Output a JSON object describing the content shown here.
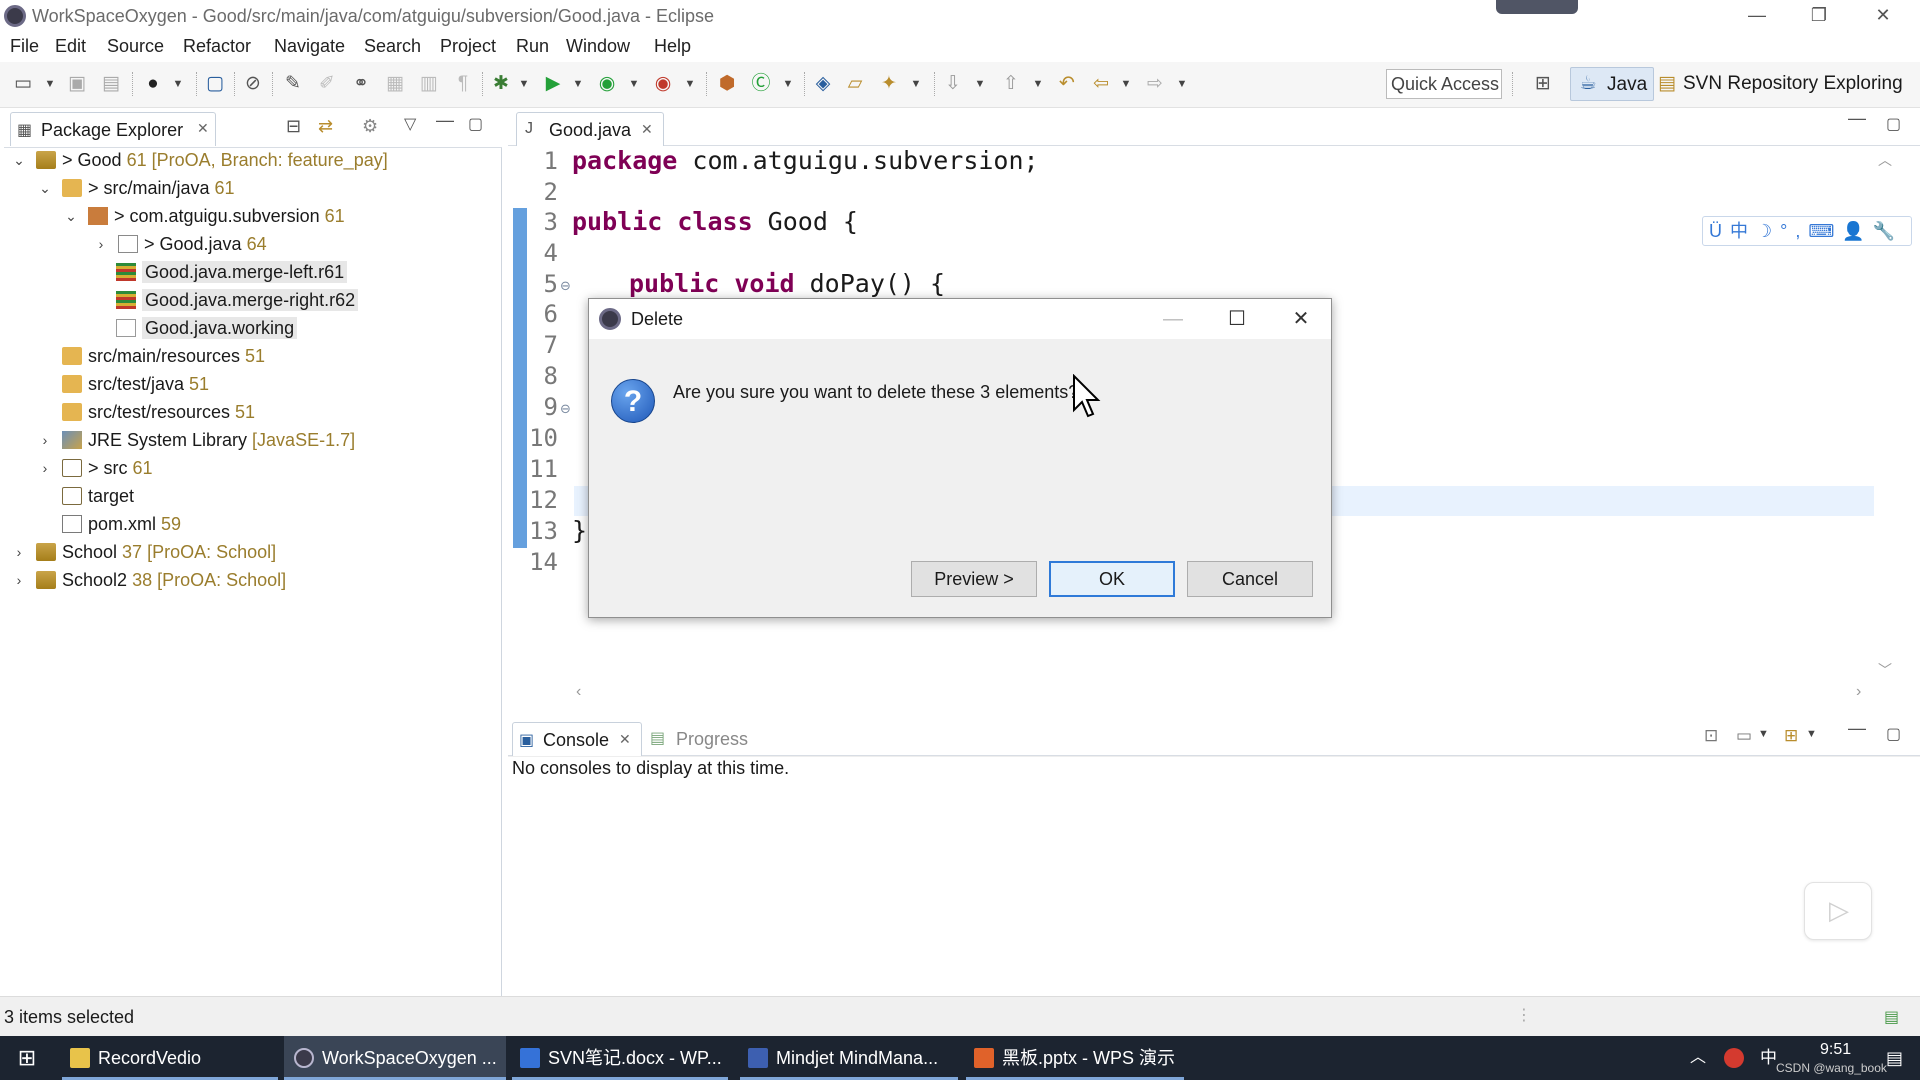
{
  "window": {
    "title": "WorkSpaceOxygen - Good/src/main/java/com/atguigu/subversion/Good.java - Eclipse"
  },
  "menu": [
    "File",
    "Edit",
    "Source",
    "Refactor",
    "Navigate",
    "Search",
    "Project",
    "Run",
    "Window",
    "Help"
  ],
  "toolbar": {
    "quick_access": "Quick Access",
    "perspective_java": "Java",
    "perspective_svn": "SVN Repository Exploring"
  },
  "package_explorer": {
    "tab_label": "Package Explorer",
    "items": [
      {
        "prefix": "> ",
        "label": "Good",
        "dec": " 61 [ProOA, Branch: feature_pay]"
      },
      {
        "prefix": "> ",
        "label": "src/main/java",
        "dec": " 61"
      },
      {
        "prefix": "> ",
        "label": "com.atguigu.subversion",
        "dec": " 61"
      },
      {
        "prefix": "> ",
        "label": "Good.java",
        "dec": " 64"
      },
      {
        "prefix": "",
        "label": "Good.java.merge-left.r61",
        "dec": ""
      },
      {
        "prefix": "",
        "label": "Good.java.merge-right.r62",
        "dec": ""
      },
      {
        "prefix": "",
        "label": "Good.java.working",
        "dec": ""
      },
      {
        "prefix": "",
        "label": "src/main/resources",
        "dec": " 51"
      },
      {
        "prefix": "",
        "label": "src/test/java",
        "dec": " 51"
      },
      {
        "prefix": "",
        "label": "src/test/resources",
        "dec": " 51"
      },
      {
        "prefix": "",
        "label": "JRE System Library",
        "dec": " [JavaSE-1.7]"
      },
      {
        "prefix": "> ",
        "label": "src",
        "dec": " 61"
      },
      {
        "prefix": "",
        "label": "target",
        "dec": ""
      },
      {
        "prefix": "",
        "label": "pom.xml",
        "dec": " 59"
      },
      {
        "prefix": "",
        "label": "School",
        "dec": " 37 [ProOA: School]"
      },
      {
        "prefix": "",
        "label": "School2",
        "dec": " 38 [ProOA: School]"
      }
    ]
  },
  "editor": {
    "tab_label": "Good.java",
    "line_numbers": [
      "1",
      "2",
      "3",
      "4",
      "5",
      "6",
      "7",
      "8",
      "9",
      "10",
      "11",
      "12",
      "13",
      "14"
    ],
    "code": {
      "l1_kw": "package",
      "l1_rest": " com.atguigu.subversion;",
      "l3_kw": "public class",
      "l3_rest": " Good {",
      "l5_kw": "public void",
      "l5_rest": " doPay() {",
      "l13": "}"
    },
    "ime_bar": "Ü中☽°,⌨👤🔧"
  },
  "dialog": {
    "title": "Delete",
    "message": "Are you sure you want to delete these 3 elements?",
    "preview_label": "Preview >",
    "ok_label": "OK",
    "cancel_label": "Cancel"
  },
  "console": {
    "tab_label": "Console",
    "progress_label": "Progress",
    "message": "No consoles to display at this time."
  },
  "status": {
    "text": "3 items selected"
  },
  "taskbar": {
    "items": [
      "RecordVedio",
      "WorkSpaceOxygen ...",
      "SVN笔记.docx - WP...",
      "Mindjet MindMana...",
      "黑板.pptx - WPS 演示"
    ],
    "tray_lang": "中",
    "clock": "9:51",
    "watermark": "CSDN @wang_book"
  },
  "colors": {
    "keyword": "#7f0055",
    "accent": "#2f7ad8",
    "taskbar": "#1c2430"
  }
}
